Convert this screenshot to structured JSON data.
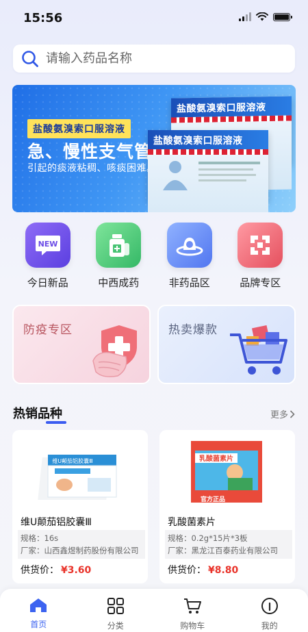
{
  "status_bar": {
    "time": "15:56"
  },
  "search": {
    "placeholder": "请输入药品名称"
  },
  "banner": {
    "tag": "盐酸氨溴索口服溶液",
    "headline": "急、慢性支气管炎",
    "subline": "引起的痰液粘稠、咳痰困难。",
    "box_title": "盐酸氨溴索口服溶液"
  },
  "categories": [
    {
      "label": "今日新品",
      "icon": "new-icon",
      "icon_text": "NEW"
    },
    {
      "label": "中西成药",
      "icon": "medicine-bottle-icon"
    },
    {
      "label": "非药品区",
      "icon": "non-drug-icon"
    },
    {
      "label": "品牌专区",
      "icon": "brand-icon"
    }
  ],
  "promos": [
    {
      "title": "防疫专区",
      "icon": "epidemic-shield-icon"
    },
    {
      "title": "热卖爆款",
      "icon": "shopping-cart-hot-icon"
    }
  ],
  "hot": {
    "title": "热销品种",
    "more": "更多",
    "products": [
      {
        "name": "维U颠茄铝胶囊Ⅲ",
        "spec": "规格：16s",
        "maker": "厂家：山西鑫煜制药股份有限公司",
        "price_label": "供货价：",
        "price": "¥3.60",
        "box_text": "维U颠茄铝胶囊Ⅲ"
      },
      {
        "name": "乳酸菌素片",
        "spec": "规格：0.2g*15片*3板",
        "maker": "厂家：黑龙江百泰药业有限公司",
        "price_label": "供货价：",
        "price": "¥8.80",
        "box_text": "乳酸菌素片",
        "badge": "官方正品"
      }
    ]
  },
  "tabbar": [
    {
      "label": "首页",
      "icon": "home-icon",
      "active": true
    },
    {
      "label": "分类",
      "icon": "category-icon",
      "active": false
    },
    {
      "label": "购物车",
      "icon": "cart-icon",
      "active": false
    },
    {
      "label": "我的",
      "icon": "profile-icon",
      "active": false
    }
  ],
  "colors": {
    "accent": "#3c63f0",
    "price": "#e9332a"
  }
}
